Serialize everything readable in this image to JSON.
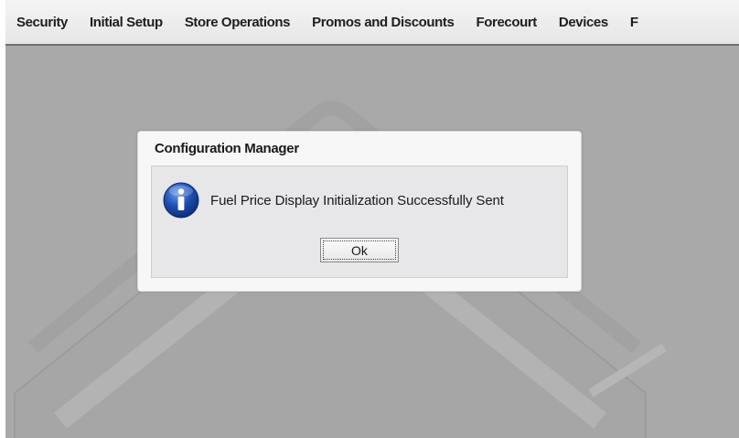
{
  "menubar": {
    "items": [
      {
        "label": "Security"
      },
      {
        "label": "Initial Setup"
      },
      {
        "label": "Store Operations"
      },
      {
        "label": "Promos and Discounts"
      },
      {
        "label": "Forecourt"
      },
      {
        "label": "Devices"
      },
      {
        "label": "F"
      }
    ]
  },
  "dialog": {
    "title": "Configuration Manager",
    "icon": "info-icon",
    "message": "Fuel Price Display Initialization Successfully Sent",
    "ok_label": "Ok"
  },
  "colors": {
    "workspace_background": "#a9a9a9",
    "icon_blue": "#1e4fb4"
  }
}
